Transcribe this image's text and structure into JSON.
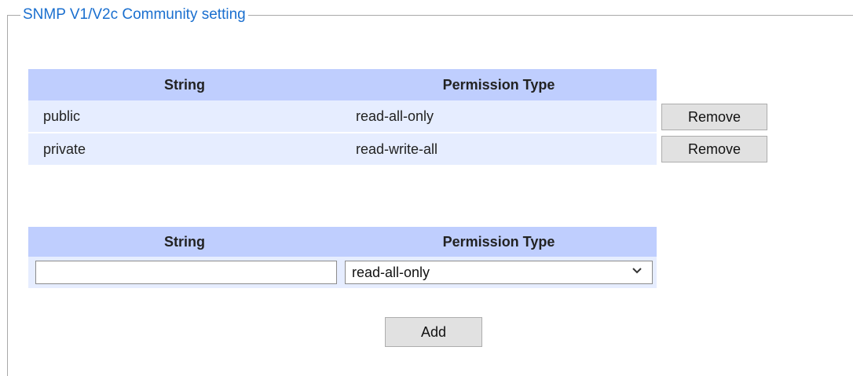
{
  "section": {
    "legend": "SNMP V1/V2c Community setting"
  },
  "community_table": {
    "headers": [
      "String",
      "Permission Type"
    ],
    "rows": [
      {
        "string": "public",
        "permission": "read-all-only",
        "action": "Remove"
      },
      {
        "string": "private",
        "permission": "read-write-all",
        "action": "Remove"
      }
    ]
  },
  "add_form": {
    "headers": [
      "String",
      "Permission Type"
    ],
    "string_value": "",
    "permission_selected": "read-all-only",
    "add_label": "Add",
    "dropdown_icon": "chevron-down-icon"
  },
  "colors": {
    "legend_text": "#1a6fcf",
    "header_bg": "#bfcefe",
    "row_bg": "#e6edff",
    "button_bg": "#e1e1e1"
  }
}
